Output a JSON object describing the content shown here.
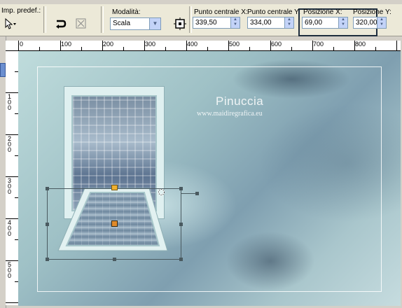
{
  "toolbar": {
    "preset_label": "Imp. predef.:",
    "mode_label": "Modalità:",
    "mode_value": "Scala",
    "center_x_label": "Punto centrale X:",
    "center_x_value": "339,50",
    "center_y_label": "Punto centrale Y:",
    "center_y_value": "334,00",
    "pos_x_label": "Posizione X:",
    "pos_x_value": "69,00",
    "pos_y_label": "Posizione Y:",
    "pos_y_value": "320,00"
  },
  "ruler": {
    "h_ticks": [
      "0",
      "100",
      "200",
      "300",
      "400",
      "500",
      "600",
      "700",
      "800"
    ],
    "v_ticks": [
      "1 0 0",
      "2 0 0",
      "3 0 0",
      "4 0 0",
      "5 0 0"
    ]
  },
  "canvas": {
    "watermark_title": "Pinuccia",
    "watermark_url": "www.maidiregrafica.eu"
  },
  "icons": {
    "pointer": "pointer-icon",
    "flip": "flip-icon",
    "reset": "reset-icon",
    "anchor": "anchor-icon"
  }
}
